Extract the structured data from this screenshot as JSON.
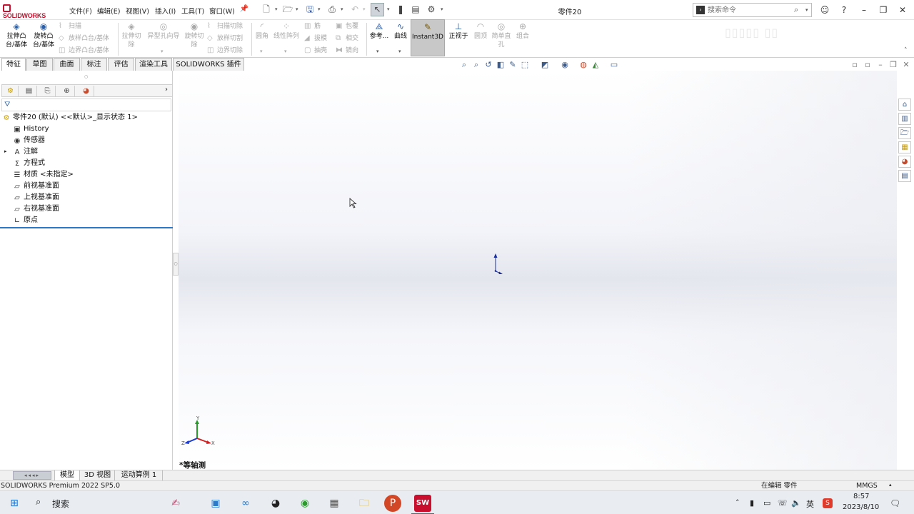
{
  "brand": {
    "logo_text": "SOLIDWORKS"
  },
  "menu": [
    "文件(F)",
    "编辑(E)",
    "视图(V)",
    "插入(I)",
    "工具(T)",
    "窗口(W)"
  ],
  "document_title": "零件20",
  "search": {
    "placeholder": "搜索命令"
  },
  "ribbon": {
    "extrude_boss": "拉伸凸\n台/基体",
    "revolve_boss": "旋转凸\n台/基体",
    "sweep": "扫描",
    "loft": "放样凸台/基体",
    "boundary": "边界凸台/基体",
    "extrude_cut": "拉伸切\n除",
    "hole_wizard": "异型孔向导",
    "revolve_cut": "旋转切\n除",
    "swept_cut": "扫描切除",
    "lofted_cut": "放样切割",
    "boundary_cut": "边界切除",
    "fillet": "圆角",
    "linear_pattern": "线性阵列",
    "rib": "筋",
    "draft": "拔模",
    "shell": "抽壳",
    "wrap": "包覆",
    "intersect": "相交",
    "mirror": "镜向",
    "reference": "参考...",
    "curves": "曲线",
    "instant3d": "Instant3D",
    "normal_to": "正视于",
    "dome": "圆顶",
    "simple_hole": "简单直\n孔",
    "combine": "组合"
  },
  "tabs": [
    "特征",
    "草图",
    "曲面",
    "标注",
    "评估",
    "渲染工具",
    "SOLIDWORKS 插件"
  ],
  "feature_tree": {
    "root": "零件20 (默认) <<默认>_显示状态 1>",
    "items": [
      "History",
      "传感器",
      "注解",
      "方程式",
      "材质 <未指定>",
      "前视基准面",
      "上视基准面",
      "右视基准面",
      "原点"
    ]
  },
  "viewport": {
    "view_name": "*等轴测",
    "axis_x": "X",
    "axis_y": "Y",
    "axis_z": "Z"
  },
  "bottom_tabs": [
    "模型",
    "3D 视图",
    "运动算例 1"
  ],
  "status": {
    "product": "SOLIDWORKS Premium 2022 SP5.0",
    "editing": "在编辑 零件",
    "units": "MMGS"
  },
  "taskbar": {
    "search": "搜索",
    "ime": "英",
    "time": "8:57",
    "date": "2023/8/10"
  },
  "colors": {
    "accent": "#2a78c8",
    "brand": "#c8102e",
    "instant3d_bg": "#c8c8c8"
  }
}
